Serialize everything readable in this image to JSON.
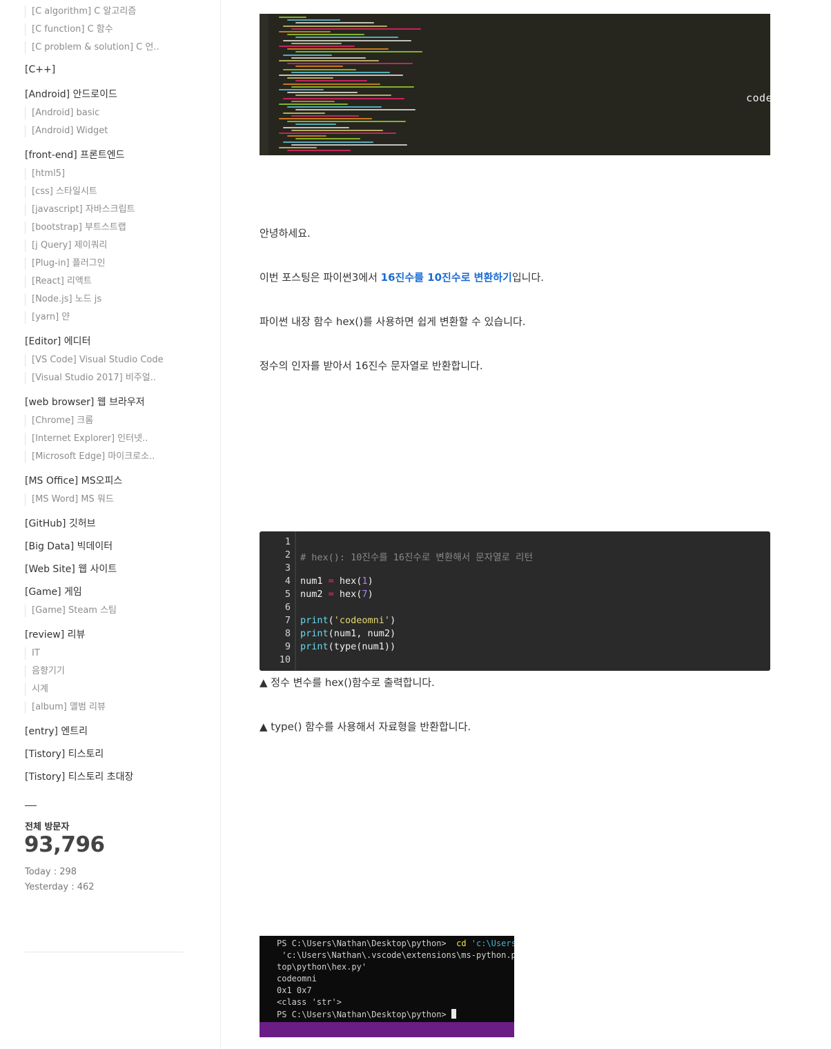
{
  "sidebar": {
    "items": [
      {
        "label": "[C algorithm] C 알고리즘",
        "level": "sub"
      },
      {
        "label": "[C function] C 함수",
        "level": "sub"
      },
      {
        "label": "[C problem & solution] C 언..",
        "level": "sub"
      },
      {
        "label": "[C++]",
        "level": "category"
      },
      {
        "label": "[Android] 안드로이드",
        "level": "category"
      },
      {
        "label": "[Android] basic",
        "level": "sub"
      },
      {
        "label": "[Android] Widget",
        "level": "sub"
      },
      {
        "label": "[front-end] 프론트엔드",
        "level": "category"
      },
      {
        "label": "[html5]",
        "level": "sub"
      },
      {
        "label": "[css] 스타일시트",
        "level": "sub"
      },
      {
        "label": "[javascript] 자바스크립트",
        "level": "sub"
      },
      {
        "label": "[bootstrap] 부트스트랩",
        "level": "sub"
      },
      {
        "label": "[j Query] 제이쿼리",
        "level": "sub"
      },
      {
        "label": "[Plug-in] 플러그인",
        "level": "sub"
      },
      {
        "label": "[React] 리액트",
        "level": "sub"
      },
      {
        "label": "[Node.js] 노드 js",
        "level": "sub"
      },
      {
        "label": "[yarn] 얀",
        "level": "sub"
      },
      {
        "label": "[Editor] 에디터",
        "level": "category"
      },
      {
        "label": "[VS Code] Visual Studio Code",
        "level": "sub"
      },
      {
        "label": "[Visual Studio 2017] 비주얼..",
        "level": "sub"
      },
      {
        "label": "[web browser] 웹 브라우저",
        "level": "category"
      },
      {
        "label": "[Chrome] 크롬",
        "level": "sub"
      },
      {
        "label": "[Internet Explorer] 인터넷..",
        "level": "sub"
      },
      {
        "label": "[Microsoft Edge] 마이크로소..",
        "level": "sub"
      },
      {
        "label": "[MS Office] MS오피스",
        "level": "category"
      },
      {
        "label": "[MS Word] MS 워드",
        "level": "sub"
      },
      {
        "label": "[GitHub] 깃허브",
        "level": "category"
      },
      {
        "label": "[Big Data] 빅데이터",
        "level": "category"
      },
      {
        "label": "[Web Site] 웹 사이트",
        "level": "category"
      },
      {
        "label": "[Game] 게임",
        "level": "category"
      },
      {
        "label": "[Game] Steam 스팀",
        "level": "sub"
      },
      {
        "label": "[review] 리뷰",
        "level": "category"
      },
      {
        "label": "IT",
        "level": "sub"
      },
      {
        "label": "음향기기",
        "level": "sub"
      },
      {
        "label": "시계",
        "level": "sub"
      },
      {
        "label": "[album] 앨범 리뷰",
        "level": "sub"
      },
      {
        "label": "[entry] 엔트리",
        "level": "category"
      },
      {
        "label": "[Tistory] 티스토리",
        "level": "category"
      },
      {
        "label": "[Tistory] 티스토리 초대장",
        "level": "category"
      }
    ],
    "visitors": {
      "title": "전체 방문자",
      "total": "93,796",
      "today_label": "Today : 298",
      "yesterday_label": "Yesterday : 462"
    }
  },
  "main": {
    "top_image": {
      "watermark": "codeomni"
    },
    "greeting": "안녕하세요.",
    "intro_before": "이번 포스팅은 파이썬3에서 ",
    "intro_highlight": "16진수를 10진수로 변환하기",
    "intro_after": "입니다.",
    "para_hex": "파이썬 내장 함수 hex()를 사용하면 쉽게 변환할 수 있습니다.",
    "para_return": "정수의 인자를 받아서 16진수 문자열로 반환합니다.",
    "code": {
      "line_numbers": [
        "1",
        "2",
        "3",
        "4",
        "5",
        "6",
        "7",
        "8",
        "9",
        "10"
      ],
      "comment": "# hex(): 10진수를 16진수로 변환해서 문자열로 리턴",
      "l4_var": "num1",
      "l4_op": " = ",
      "l4_fn": "hex(",
      "l4_num": "1",
      "l4_close": ")",
      "l5_var": "num2",
      "l5_op": " = ",
      "l5_fn": "hex(",
      "l5_num": "7",
      "l5_close": ")",
      "l7_kw": "print",
      "l7_open": "(",
      "l7_str": "'codeomni'",
      "l7_close": ")",
      "l8_kw": "print",
      "l8_rest": "(num1, num2)",
      "l9_kw": "print",
      "l9_rest": "(type(num1))"
    },
    "caption_hex": "▲ 정수 변수를 hex()함수로 출력합니다.",
    "caption_type": "▲ type() 함수를 사용해서 자료형을 반환합니다.",
    "terminal": {
      "l1_prompt": "PS C:\\Users\\Nathan\\Desktop\\python>  ",
      "l1_cmd": "cd",
      "l1_path": " 'c:\\Users\\",
      "l2": " 'c:\\Users\\Nathan\\.vscode\\extensions\\ms-python.py",
      "l3": "top\\python\\hex.py'",
      "l4": "codeomni",
      "l5": "0x1 0x7",
      "l6": "<class 'str'>",
      "l7_prompt": "PS C:\\Users\\Nathan\\Desktop\\python> "
    }
  }
}
